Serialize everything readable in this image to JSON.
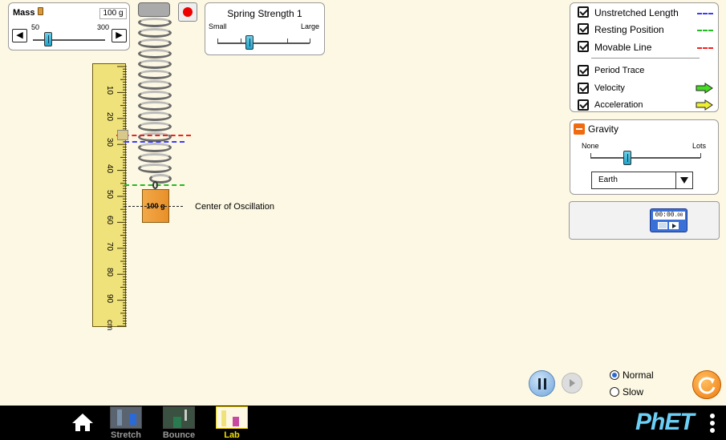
{
  "mass_panel": {
    "title": "Mass",
    "value": "100 g",
    "min_label": "50",
    "max_label": "300",
    "slider_fraction": 0.2
  },
  "spring_panel": {
    "title": "Spring Strength 1",
    "min_label": "Small",
    "max_label": "Large",
    "slider_fraction": 0.5
  },
  "ruler": {
    "ticks": [
      "10",
      "20",
      "30",
      "40",
      "50",
      "60",
      "70",
      "80",
      "90",
      "cm"
    ]
  },
  "mass_block": {
    "label": "100 g"
  },
  "center_label": "Center of Oscillation",
  "display_panel": {
    "items": [
      {
        "label": "Unstretched Length",
        "checked": true,
        "line_color": "#3b3bff"
      },
      {
        "label": "Resting Position",
        "checked": true,
        "line_color": "#22bb22"
      },
      {
        "label": "Movable Line",
        "checked": true,
        "line_color": "#ee2222"
      },
      {
        "label": "Period Trace",
        "checked": true
      },
      {
        "label": "Velocity",
        "checked": true,
        "arrow_color": "#44dd22"
      },
      {
        "label": "Acceleration",
        "checked": true,
        "arrow_color": "#eeee33"
      }
    ]
  },
  "gravity_panel": {
    "title": "Gravity",
    "min_label": "None",
    "max_label": "Lots",
    "slider_fraction": 0.33,
    "planet": "Earth"
  },
  "stopwatch": {
    "time": "00:00",
    "hundredths": ".00"
  },
  "playback": {
    "speed_options": [
      "Normal",
      "Slow"
    ],
    "selected_speed": "Normal"
  },
  "nav": {
    "screens": [
      "Stretch",
      "Bounce",
      "Lab"
    ],
    "selected": "Lab",
    "brand": "PhET"
  }
}
